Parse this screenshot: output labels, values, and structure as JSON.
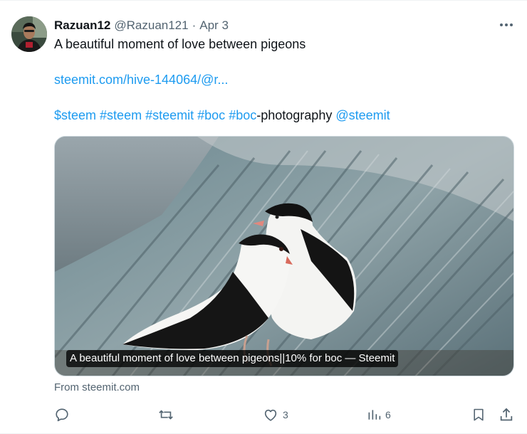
{
  "tweet": {
    "display_name": "Razuan12",
    "handle": "@Razuan121",
    "separator": "·",
    "date": "Apr 3",
    "text": "A beautiful moment of love between pigeons",
    "link_text": "steemit.com/hive-144064/@r...",
    "tags": {
      "steem_cashtag": "$steem",
      "steem_hashtag": "#steem",
      "steemit_hashtag": "#steemit",
      "boc_hashtag": "#boc",
      "boc_photo_hashtag": "#boc",
      "photography_suffix": "-photography",
      "mention": "@steemit"
    },
    "card_caption": "A beautiful moment of love between pigeons||10% for boc — Steemit",
    "card_source": "From steemit.com"
  },
  "actions": {
    "reply_icon": "reply-icon",
    "retweet_icon": "retweet-icon",
    "like_icon": "heart-icon",
    "like_count": "3",
    "views_icon": "views-icon",
    "view_count": "6",
    "bookmark_icon": "bookmark-icon",
    "share_icon": "share-icon"
  },
  "colors": {
    "link": "#1d9bf0",
    "secondary_text": "#536471",
    "primary_text": "#0f1419"
  }
}
